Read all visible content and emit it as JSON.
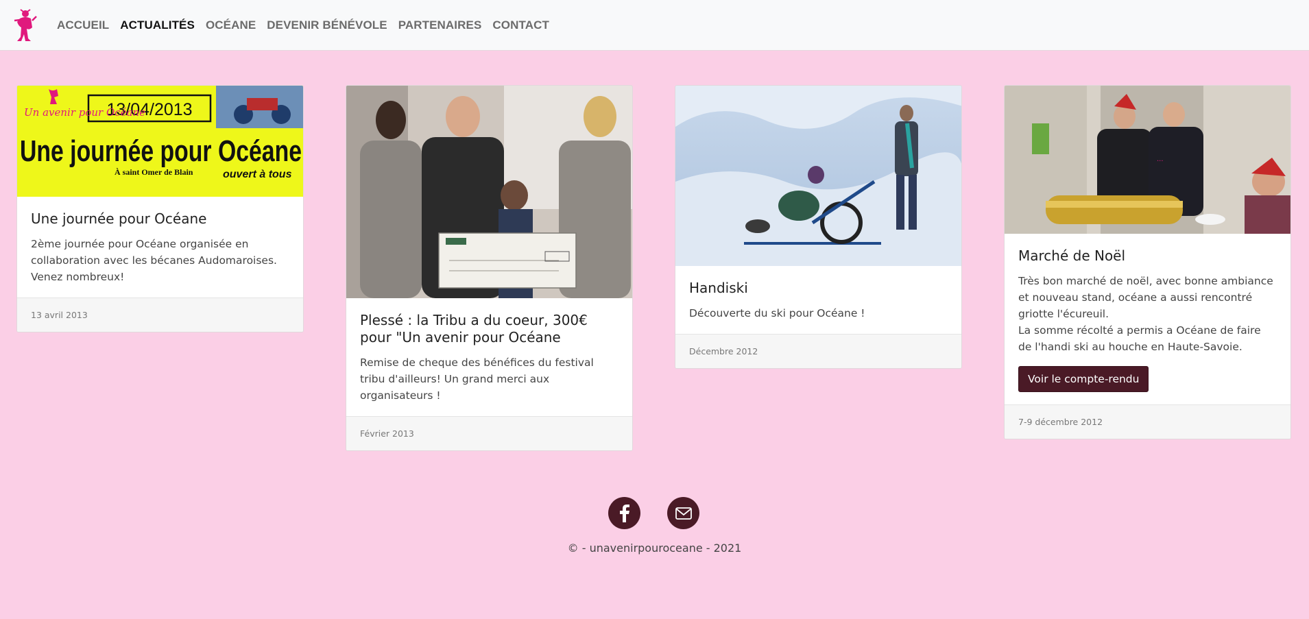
{
  "nav": {
    "items": [
      {
        "label": "ACCUEIL",
        "active": false
      },
      {
        "label": "ACTUALITÉS",
        "active": true
      },
      {
        "label": "OCÉANE",
        "active": false
      },
      {
        "label": "DEVENIR BÉNÉVOLE",
        "active": false
      },
      {
        "label": "PARTENAIRES",
        "active": false
      },
      {
        "label": "CONTACT",
        "active": false
      }
    ]
  },
  "cards": [
    {
      "title": "Une journée pour Océane",
      "text": "2ème journée pour Océane organisée en collaboration avec les bécanes Audomaroises. Venez nombreux!",
      "date": "13 avril 2013",
      "poster": {
        "date": "13/04/2013",
        "brand": "Un avenir pour Océane",
        "headline": "Une journée pour Océane",
        "location": "À saint Omer de Blain",
        "open": "ouvert à tous"
      }
    },
    {
      "title": "Plessé : la Tribu a du coeur, 300€ pour \"Un avenir pour Océane",
      "text": "Remise de cheque des bénéfices du festival tribu d'ailleurs! Un grand merci aux organisateurs !",
      "date": "Février 2013"
    },
    {
      "title": "Handiski",
      "text": "Découverte du ski pour Océane !",
      "date": "Décembre 2012"
    },
    {
      "title": "Marché de Noël",
      "text_lines": [
        "Très bon marché de noël, avec bonne ambiance et nouveau stand, océane a aussi rencontré griotte l'écureuil.",
        "La somme récolté a permis a Océane de faire de l'handi ski au houche en Haute-Savoie."
      ],
      "button_label": "Voir le compte-rendu",
      "date": "7-9 décembre 2012"
    }
  ],
  "footer": {
    "copyright": "© - unavenirpouroceane - 2021",
    "icons": [
      "facebook-icon",
      "mail-icon"
    ]
  },
  "colors": {
    "background": "#fbcfe6",
    "accent": "#4a1a26",
    "logo": "#e0197d"
  }
}
